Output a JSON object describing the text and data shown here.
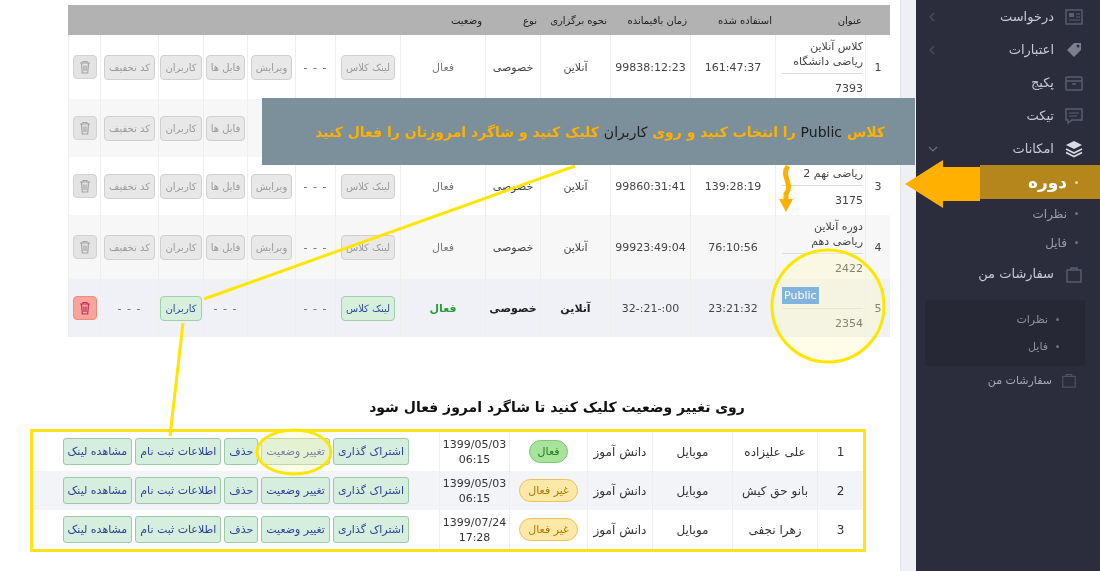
{
  "sidebar": {
    "items": [
      {
        "kind": "item",
        "label": "درخواست",
        "expanded": false
      },
      {
        "kind": "item",
        "label": "اعتبارات",
        "expanded": false
      },
      {
        "kind": "item",
        "label": "پکیج"
      },
      {
        "kind": "item",
        "label": "تیکت"
      },
      {
        "kind": "item",
        "label": "امکانات",
        "expanded": true,
        "children": [
          {
            "label": "دوره",
            "selected": true
          },
          {
            "label": "نظرات",
            "selected": false
          },
          {
            "label": "فایل",
            "selected": false
          }
        ]
      },
      {
        "kind": "item",
        "label": "سفارشات من"
      },
      {
        "kind": "panel",
        "children": [
          {
            "label": "نظرات",
            "selected": false
          },
          {
            "label": "فایل",
            "selected": false
          }
        ]
      },
      {
        "kind": "small-item",
        "label": "سفارشات من"
      }
    ]
  },
  "courses": {
    "columns": [
      "عنوان",
      "استفاده شده",
      "زمان باقیمانده",
      "نحوه برگزاری",
      "نوع",
      "وضعیت"
    ],
    "rows": [
      {
        "number": "1",
        "title": "کلاس آنلاین ریاضی دانشگاه",
        "title_highlighted": false,
        "code": "7393",
        "used": "161:47:37",
        "remaining": "99838:12:23",
        "mode": "آنلاین",
        "type": "خصوصی",
        "status": "فعال",
        "active": false,
        "actions": [
          {
            "kind": "button",
            "label": "لینک کلاس"
          },
          {
            "kind": "dash",
            "label": "- - -"
          },
          {
            "kind": "button",
            "label": "ویرایش"
          },
          {
            "kind": "button",
            "label": "فایل ها"
          },
          {
            "kind": "button",
            "label": "کاربران"
          },
          {
            "kind": "button",
            "label": "کد تخفیف"
          },
          {
            "kind": "trash"
          }
        ]
      },
      {
        "active": false,
        "actions": [
          {
            "kind": "none"
          },
          {
            "kind": "none"
          },
          {
            "kind": "none"
          },
          {
            "kind": "button",
            "label": "فایل ها"
          },
          {
            "kind": "button",
            "label": "کاربران"
          },
          {
            "kind": "button",
            "label": "کد تخفیف"
          },
          {
            "kind": "trash"
          }
        ]
      },
      {
        "number": "3",
        "title": "ریاضی نهم 2",
        "title_highlighted": false,
        "code": "3175",
        "used": "139:28:19",
        "remaining": "99860:31:41",
        "mode": "آنلاین",
        "type": "خصوصی",
        "status": "فعال",
        "active": false,
        "actions": [
          {
            "kind": "button",
            "label": "لینک کلاس"
          },
          {
            "kind": "dash",
            "label": "- - -"
          },
          {
            "kind": "button",
            "label": "ویرایش"
          },
          {
            "kind": "button",
            "label": "فایل ها"
          },
          {
            "kind": "button",
            "label": "کاربران"
          },
          {
            "kind": "button",
            "label": "کد تخفیف"
          },
          {
            "kind": "trash"
          }
        ]
      },
      {
        "number": "4",
        "title": "دوره آنلاین ریاضی دهم",
        "title_highlighted": false,
        "code": "2422",
        "used": "76:10:56",
        "remaining": "99923:49:04",
        "mode": "آنلاین",
        "type": "خصوصی",
        "status": "فعال",
        "active": false,
        "actions": [
          {
            "kind": "button",
            "label": "لینک کلاس"
          },
          {
            "kind": "dash",
            "label": "- - -"
          },
          {
            "kind": "button",
            "label": "ویرایش"
          },
          {
            "kind": "button",
            "label": "فایل ها"
          },
          {
            "kind": "button",
            "label": "کاربران"
          },
          {
            "kind": "button",
            "label": "کد تخفیف"
          },
          {
            "kind": "trash"
          }
        ]
      },
      {
        "number": "5",
        "title": "Public",
        "title_highlighted": true,
        "code": "2354",
        "used": "23:21:32",
        "remaining": "32-:21-:00",
        "mode": "آنلاین",
        "type": "خصوصی",
        "status": "فعال",
        "active": true,
        "actions": [
          {
            "kind": "button",
            "label": "لینک کلاس"
          },
          {
            "kind": "dash",
            "label": "- - -"
          },
          {
            "kind": "none"
          },
          {
            "kind": "dash",
            "label": "- - -"
          },
          {
            "kind": "button",
            "label": "کاربران"
          },
          {
            "kind": "dash",
            "label": "- - -"
          },
          {
            "kind": "trash"
          }
        ]
      }
    ]
  },
  "annotations": {
    "banner": [
      {
        "text": "کلاس",
        "emphasis": false
      },
      {
        "text": "Public",
        "emphasis": true
      },
      {
        "text": "را انتخاب کنید و روی",
        "emphasis": false
      },
      {
        "text": "کاربران",
        "emphasis": true
      },
      {
        "text": "کلیک کنید و شاگرد امروزتان را فعال کنید",
        "emphasis": false
      }
    ],
    "caption": "روی تغییر وضعیت کلیک کنید تا شاگرد امروز فعال شود"
  },
  "users": {
    "rows": [
      {
        "number": "1",
        "name": "علی علیزاده",
        "device": "موبایل",
        "role": "دانش آموز",
        "status": "فعال",
        "active": true,
        "date": "1399/05/03",
        "time": "06:15",
        "actions": [
          "اشتراک گذاری",
          "تغییر وضعیت",
          "حذف",
          "اطلاعات ثبت نام",
          "مشاهده لینک"
        ]
      },
      {
        "number": "2",
        "name": "بانو حق کیش",
        "device": "موبایل",
        "role": "دانش آموز",
        "status": "غیر فعال",
        "active": false,
        "date": "1399/05/03",
        "time": "06:15",
        "actions": [
          "اشتراک گذاری",
          "تغییر وضعیت",
          "حذف",
          "اطلاعات ثبت نام",
          "مشاهده لینک"
        ]
      },
      {
        "number": "3",
        "name": "زهرا نجفی",
        "device": "موبایل",
        "role": "دانش آموز",
        "status": "غیر فعال",
        "active": false,
        "date": "1399/07/24",
        "time": "17:28",
        "actions": [
          "اشتراک گذاری",
          "تغییر وضعیت",
          "حذف",
          "اطلاعات ثبت نام",
          "مشاهده لینک"
        ]
      }
    ]
  }
}
